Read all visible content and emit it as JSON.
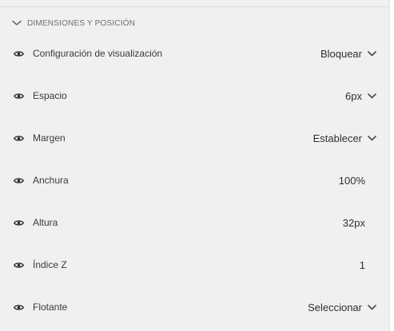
{
  "section": {
    "title": "DIMENSIONES Y POSICIÓN"
  },
  "properties": [
    {
      "label": "Configuración de visualización",
      "value": "Bloquear",
      "type": "dropdown"
    },
    {
      "label": "Espacio",
      "value": "6px",
      "type": "dropdown"
    },
    {
      "label": "Margen",
      "value": "Establecer",
      "type": "dropdown"
    },
    {
      "label": "Anchura",
      "value": "100%",
      "type": "static"
    },
    {
      "label": "Altura",
      "value": "32px",
      "type": "static"
    },
    {
      "label": "Índice Z",
      "value": "1",
      "type": "static"
    },
    {
      "label": "Flotante",
      "value": "Seleccionar",
      "type": "dropdown"
    }
  ],
  "icons": {
    "section_toggle": "chevron-down-icon",
    "visibility": "eye-icon",
    "dropdown": "chevron-down-icon"
  },
  "colors": {
    "background": "#f0f0f0",
    "text": "#2f2f2f",
    "muted": "#6e6e6e"
  }
}
